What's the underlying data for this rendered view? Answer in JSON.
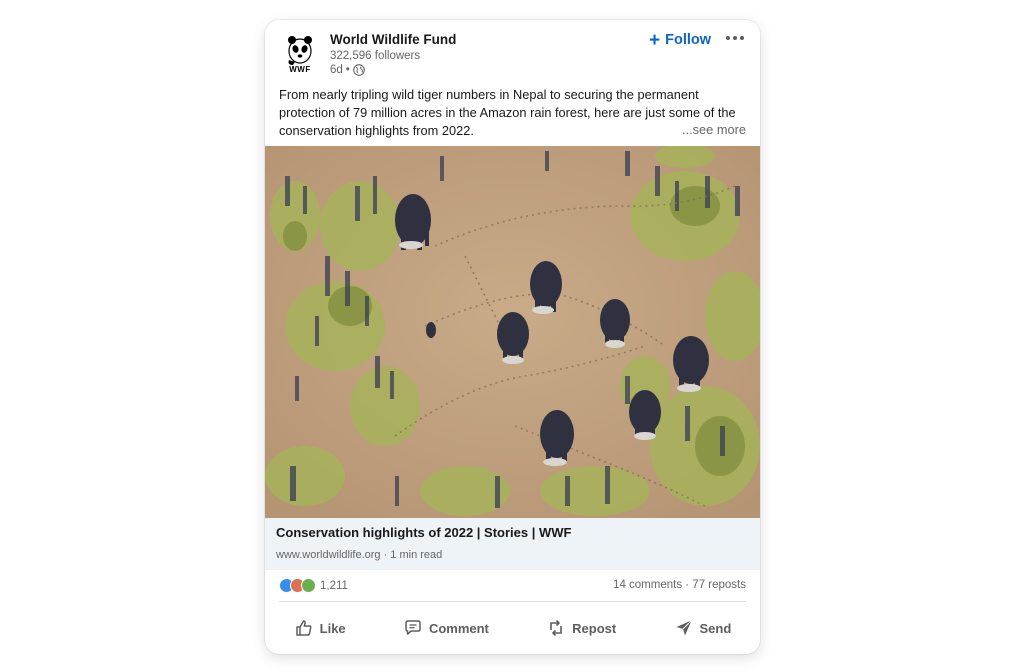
{
  "post": {
    "org_name": "World Wildlife Fund",
    "followers": "322,596 followers",
    "time": "6d",
    "separator": "•",
    "logo_text": "WWF",
    "follow_label": "Follow",
    "text": "From nearly tripling wild tiger numbers in Nepal to securing the permanent protection of 79 million acres in the Amazon rain forest, here are just some of the conservation highlights from 2022.",
    "see_more": "...see more"
  },
  "link": {
    "title": "Conservation highlights of 2022 | Stories | WWF",
    "domain": "www.worldwildlife.org · 1 min read"
  },
  "social": {
    "reaction_count": "1,211",
    "counts": "14 comments · 77 reposts",
    "reaction_colors": [
      "#378fe9",
      "#df704d",
      "#6dae4f"
    ]
  },
  "actions": {
    "like": "Like",
    "comment": "Comment",
    "repost": "Repost",
    "send": "Send"
  },
  "colors": {
    "accent": "#0a66c2",
    "link_bg": "#eef3f8",
    "muted_text": "#666666"
  }
}
